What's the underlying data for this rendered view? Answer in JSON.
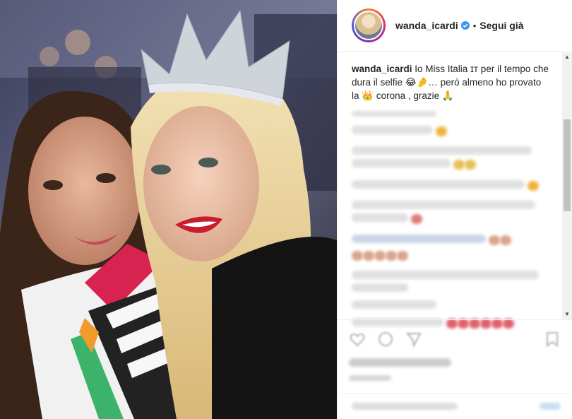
{
  "post": {
    "username": "wanda_icardi",
    "follow_status": "Segui già",
    "separator": "•",
    "caption_user": "wanda_icardi",
    "caption_text": " Io Miss Italia ɪᴛ per il tempo che dura il selfie 😂🤌… però almeno ho provato la 👑 corona , grazie 🙏"
  },
  "icons": {
    "avatar": "profile-picture",
    "verified": "verified-badge-icon",
    "like": "heart-icon",
    "comment": "comment-icon",
    "share": "share-icon",
    "save": "bookmark-icon"
  },
  "colors": {
    "verified_blue": "#3897f0",
    "text": "#262626",
    "border": "#efefef"
  }
}
